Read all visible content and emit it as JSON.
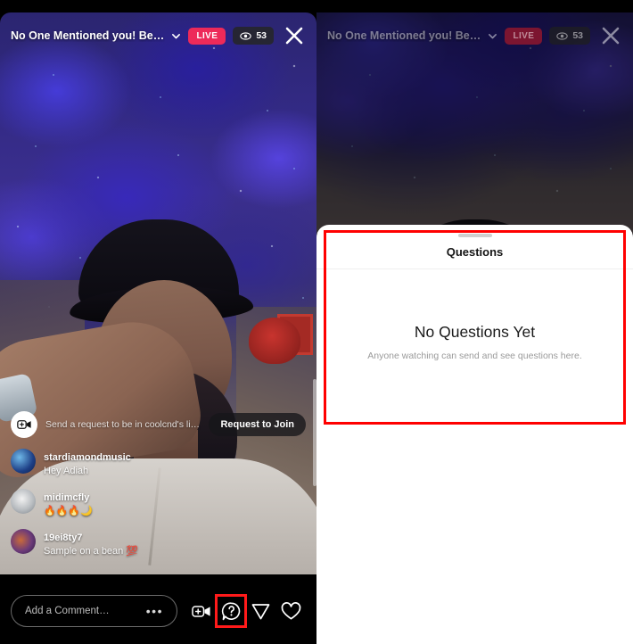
{
  "header": {
    "live_title": "No One Mentioned you! Beat talk Beat…",
    "chevron_icon": "chevron-down-icon",
    "live_label": "LIVE",
    "viewer_icon": "eye-icon",
    "viewer_count": "53",
    "close_icon": "close-icon"
  },
  "comments": {
    "join_icon": "video-add-icon",
    "join_text": "Send a request to be in coolcnd's live video.",
    "join_button": "Request to Join",
    "items": [
      {
        "username": "stardiamondmusic",
        "text": "Hey Adiah"
      },
      {
        "username": "midimcfly",
        "text": "🔥🔥🔥🌙"
      },
      {
        "username": "19ei8ty7",
        "text": "Sample on a bean 💯"
      }
    ]
  },
  "toolbar": {
    "comment_placeholder": "Add a Comment…",
    "more_icon": "more-dots-icon",
    "add_video_icon": "video-add-icon",
    "questions_icon": "question-bubble-icon",
    "share_icon": "paper-plane-icon",
    "like_icon": "heart-icon"
  },
  "sheet": {
    "grabber": "drag-handle",
    "title": "Questions",
    "empty_title": "No Questions Yet",
    "empty_subtitle": "Anyone watching can send and see questions here."
  },
  "colors": {
    "live_badge": "#ed2a59",
    "annotation": "#ff0000",
    "sheet_bg": "#ffffff",
    "app_bg": "#000000"
  }
}
